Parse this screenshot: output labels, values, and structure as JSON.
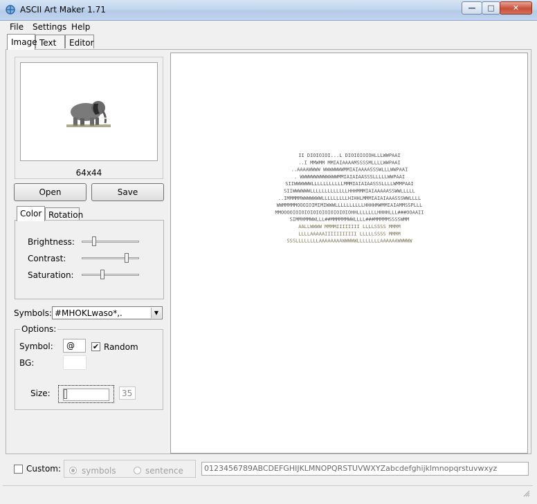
{
  "window": {
    "title": "ASCII Art Maker 1.71",
    "min_glyph": "—",
    "max_glyph": "□",
    "close_glyph": "✕"
  },
  "menu": [
    "File",
    "Settings",
    "Help"
  ],
  "tabs": [
    "Image",
    "Text",
    "Editor"
  ],
  "image_panel": {
    "image_size": "64x44",
    "open_label": "Open",
    "save_label": "Save"
  },
  "subtabs": [
    "Color",
    "Rotation"
  ],
  "color": {
    "brightness_label": "Brightness:",
    "contrast_label": "Contrast:",
    "saturation_label": "Saturation:",
    "brightness_level": 0.2,
    "contrast_level": 0.8,
    "saturation_level": 0.35
  },
  "symbols": {
    "label": "Symbols:",
    "value": "#MHOKLwaso*,."
  },
  "options": {
    "title": "Options:",
    "symbol_label": "Symbol:",
    "symbol_value": "@",
    "random_label": "Random",
    "random_checked": true,
    "bg_label": "BG:",
    "size_label": "Size:",
    "size_value": "35"
  },
  "custom": {
    "label": "Custom:",
    "checked": false,
    "radio_symbols": "symbols",
    "radio_sentence": "sentence",
    "chars": "0123456789ABCDEFGHIJKLMNOPQRSTUVWXYZabcdefghijklmnopqrstuvwxyz"
  },
  "canvas": {
    "ascii_rows": [
      "II DIOIOIOI...L  DIOIOIOIOHLLLWWPAAI",
      "..I MMWMM MMIAIAAAAMSSSSMLLLLWWPAAI",
      "..AAAAWWWW WWWWWWWMMIAIAAAASSSWLLLWWPAAI",
      ". WWWWWWWWWWWWWMMIAIAIAASSSLLLLLWWPAAI",
      "SIIWWWWWWLLLLLLLLLLLMMMIAIAIAASSSLLLLWMMPAAI",
      "SIIWWWWWWLLLLLLLLLLLLLHHHMMMIAIAAAAASSWWLLLLL",
      "..IMMMMMWWWWWWWLLLLLLLLLHIHHLMMMIAIAIAAASSSWWLLLL",
      "WWMMMMMOOOIOIMIMIWWWLLLLLLLLLLHHHHM#MMIAIAMMSSPLLL",
      "MMOOOOIOIOIOIOIOIOIOIOIOIOHHLLLLLLLHHHHLLL###OOAAII",
      "SIMMHMMWWLLL##MMMMMMWWLLLL###MMMMMSSSSWMM",
      "AALLWWWW MMMMIIIIIIII  LLLLSSSS  MMMM",
      "LLLLAAAAAIIIIIIIIIII  LLLLLSSSS  MMMM",
      "SSSLLLLLLLLAAAAAAAAWWWWWLLLLLLLLAAAAAAWWWWW"
    ]
  }
}
